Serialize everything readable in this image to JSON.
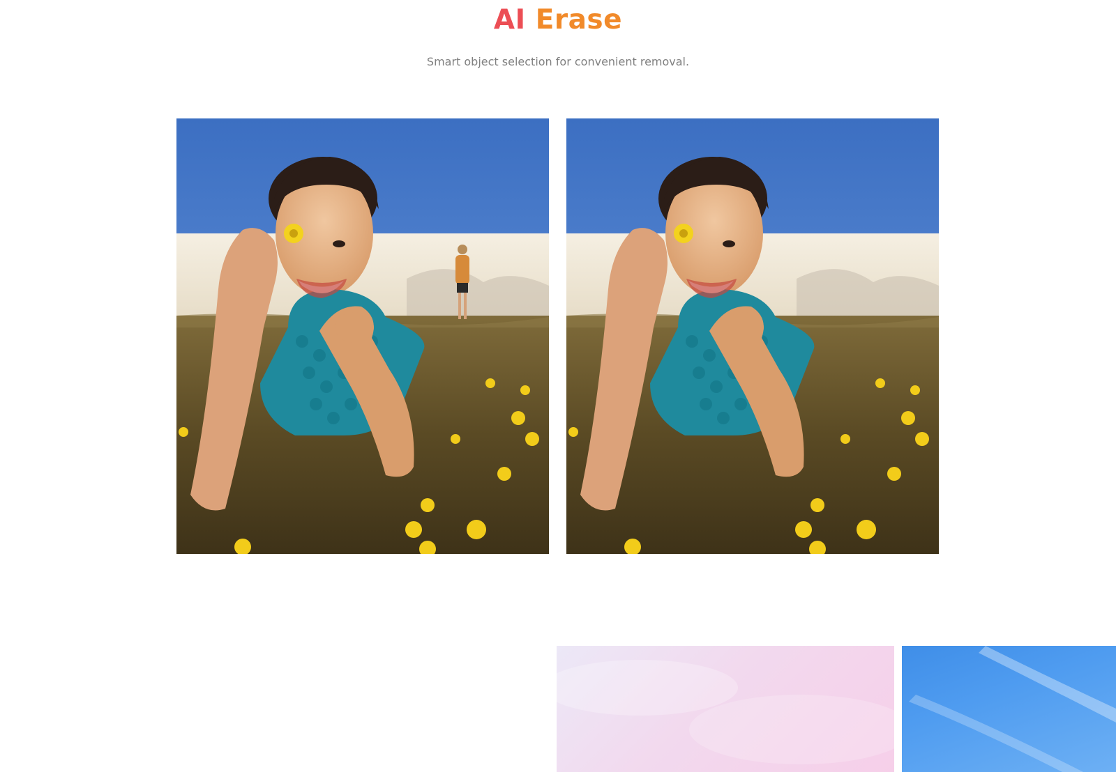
{
  "section": {
    "title_part1": "AI",
    "title_part2": "Erase",
    "subtitle": "Smart object selection for convenient removal."
  },
  "comparison": {
    "before": {
      "description_icon": "photo-with-person-in-background"
    },
    "after": {
      "description_icon": "photo-with-person-removed"
    }
  },
  "next_section": {
    "tiles": [
      {
        "name": "pink-sky-tile",
        "color": "#f3d6ec"
      },
      {
        "name": "blue-sky-tile",
        "color": "#4a96ee"
      }
    ]
  },
  "colors": {
    "title_gradient_start": "#ec4e55",
    "title_gradient_end": "#f18a2a",
    "subtitle": "#808080"
  }
}
